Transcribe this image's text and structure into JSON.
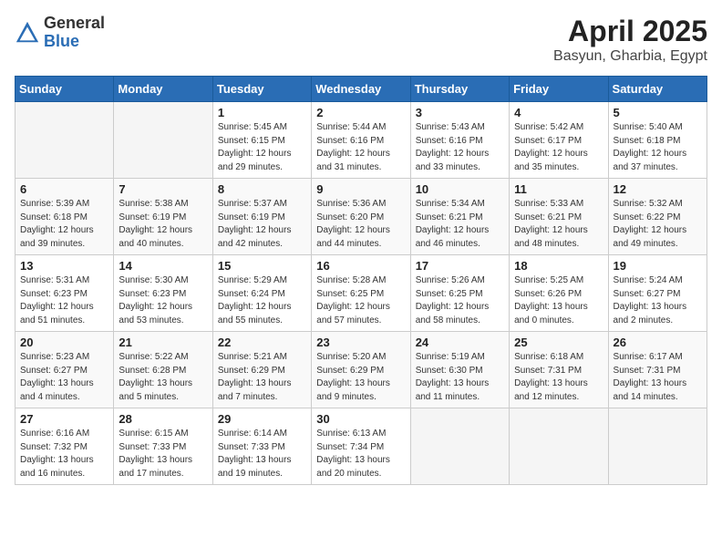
{
  "header": {
    "logo_general": "General",
    "logo_blue": "Blue",
    "title": "April 2025",
    "location": "Basyun, Gharbia, Egypt"
  },
  "days_of_week": [
    "Sunday",
    "Monday",
    "Tuesday",
    "Wednesday",
    "Thursday",
    "Friday",
    "Saturday"
  ],
  "weeks": [
    [
      {
        "day": "",
        "detail": ""
      },
      {
        "day": "",
        "detail": ""
      },
      {
        "day": "1",
        "detail": "Sunrise: 5:45 AM\nSunset: 6:15 PM\nDaylight: 12 hours\nand 29 minutes."
      },
      {
        "day": "2",
        "detail": "Sunrise: 5:44 AM\nSunset: 6:16 PM\nDaylight: 12 hours\nand 31 minutes."
      },
      {
        "day": "3",
        "detail": "Sunrise: 5:43 AM\nSunset: 6:16 PM\nDaylight: 12 hours\nand 33 minutes."
      },
      {
        "day": "4",
        "detail": "Sunrise: 5:42 AM\nSunset: 6:17 PM\nDaylight: 12 hours\nand 35 minutes."
      },
      {
        "day": "5",
        "detail": "Sunrise: 5:40 AM\nSunset: 6:18 PM\nDaylight: 12 hours\nand 37 minutes."
      }
    ],
    [
      {
        "day": "6",
        "detail": "Sunrise: 5:39 AM\nSunset: 6:18 PM\nDaylight: 12 hours\nand 39 minutes."
      },
      {
        "day": "7",
        "detail": "Sunrise: 5:38 AM\nSunset: 6:19 PM\nDaylight: 12 hours\nand 40 minutes."
      },
      {
        "day": "8",
        "detail": "Sunrise: 5:37 AM\nSunset: 6:19 PM\nDaylight: 12 hours\nand 42 minutes."
      },
      {
        "day": "9",
        "detail": "Sunrise: 5:36 AM\nSunset: 6:20 PM\nDaylight: 12 hours\nand 44 minutes."
      },
      {
        "day": "10",
        "detail": "Sunrise: 5:34 AM\nSunset: 6:21 PM\nDaylight: 12 hours\nand 46 minutes."
      },
      {
        "day": "11",
        "detail": "Sunrise: 5:33 AM\nSunset: 6:21 PM\nDaylight: 12 hours\nand 48 minutes."
      },
      {
        "day": "12",
        "detail": "Sunrise: 5:32 AM\nSunset: 6:22 PM\nDaylight: 12 hours\nand 49 minutes."
      }
    ],
    [
      {
        "day": "13",
        "detail": "Sunrise: 5:31 AM\nSunset: 6:23 PM\nDaylight: 12 hours\nand 51 minutes."
      },
      {
        "day": "14",
        "detail": "Sunrise: 5:30 AM\nSunset: 6:23 PM\nDaylight: 12 hours\nand 53 minutes."
      },
      {
        "day": "15",
        "detail": "Sunrise: 5:29 AM\nSunset: 6:24 PM\nDaylight: 12 hours\nand 55 minutes."
      },
      {
        "day": "16",
        "detail": "Sunrise: 5:28 AM\nSunset: 6:25 PM\nDaylight: 12 hours\nand 57 minutes."
      },
      {
        "day": "17",
        "detail": "Sunrise: 5:26 AM\nSunset: 6:25 PM\nDaylight: 12 hours\nand 58 minutes."
      },
      {
        "day": "18",
        "detail": "Sunrise: 5:25 AM\nSunset: 6:26 PM\nDaylight: 13 hours\nand 0 minutes."
      },
      {
        "day": "19",
        "detail": "Sunrise: 5:24 AM\nSunset: 6:27 PM\nDaylight: 13 hours\nand 2 minutes."
      }
    ],
    [
      {
        "day": "20",
        "detail": "Sunrise: 5:23 AM\nSunset: 6:27 PM\nDaylight: 13 hours\nand 4 minutes."
      },
      {
        "day": "21",
        "detail": "Sunrise: 5:22 AM\nSunset: 6:28 PM\nDaylight: 13 hours\nand 5 minutes."
      },
      {
        "day": "22",
        "detail": "Sunrise: 5:21 AM\nSunset: 6:29 PM\nDaylight: 13 hours\nand 7 minutes."
      },
      {
        "day": "23",
        "detail": "Sunrise: 5:20 AM\nSunset: 6:29 PM\nDaylight: 13 hours\nand 9 minutes."
      },
      {
        "day": "24",
        "detail": "Sunrise: 5:19 AM\nSunset: 6:30 PM\nDaylight: 13 hours\nand 11 minutes."
      },
      {
        "day": "25",
        "detail": "Sunrise: 6:18 AM\nSunset: 7:31 PM\nDaylight: 13 hours\nand 12 minutes."
      },
      {
        "day": "26",
        "detail": "Sunrise: 6:17 AM\nSunset: 7:31 PM\nDaylight: 13 hours\nand 14 minutes."
      }
    ],
    [
      {
        "day": "27",
        "detail": "Sunrise: 6:16 AM\nSunset: 7:32 PM\nDaylight: 13 hours\nand 16 minutes."
      },
      {
        "day": "28",
        "detail": "Sunrise: 6:15 AM\nSunset: 7:33 PM\nDaylight: 13 hours\nand 17 minutes."
      },
      {
        "day": "29",
        "detail": "Sunrise: 6:14 AM\nSunset: 7:33 PM\nDaylight: 13 hours\nand 19 minutes."
      },
      {
        "day": "30",
        "detail": "Sunrise: 6:13 AM\nSunset: 7:34 PM\nDaylight: 13 hours\nand 20 minutes."
      },
      {
        "day": "",
        "detail": ""
      },
      {
        "day": "",
        "detail": ""
      },
      {
        "day": "",
        "detail": ""
      }
    ]
  ]
}
